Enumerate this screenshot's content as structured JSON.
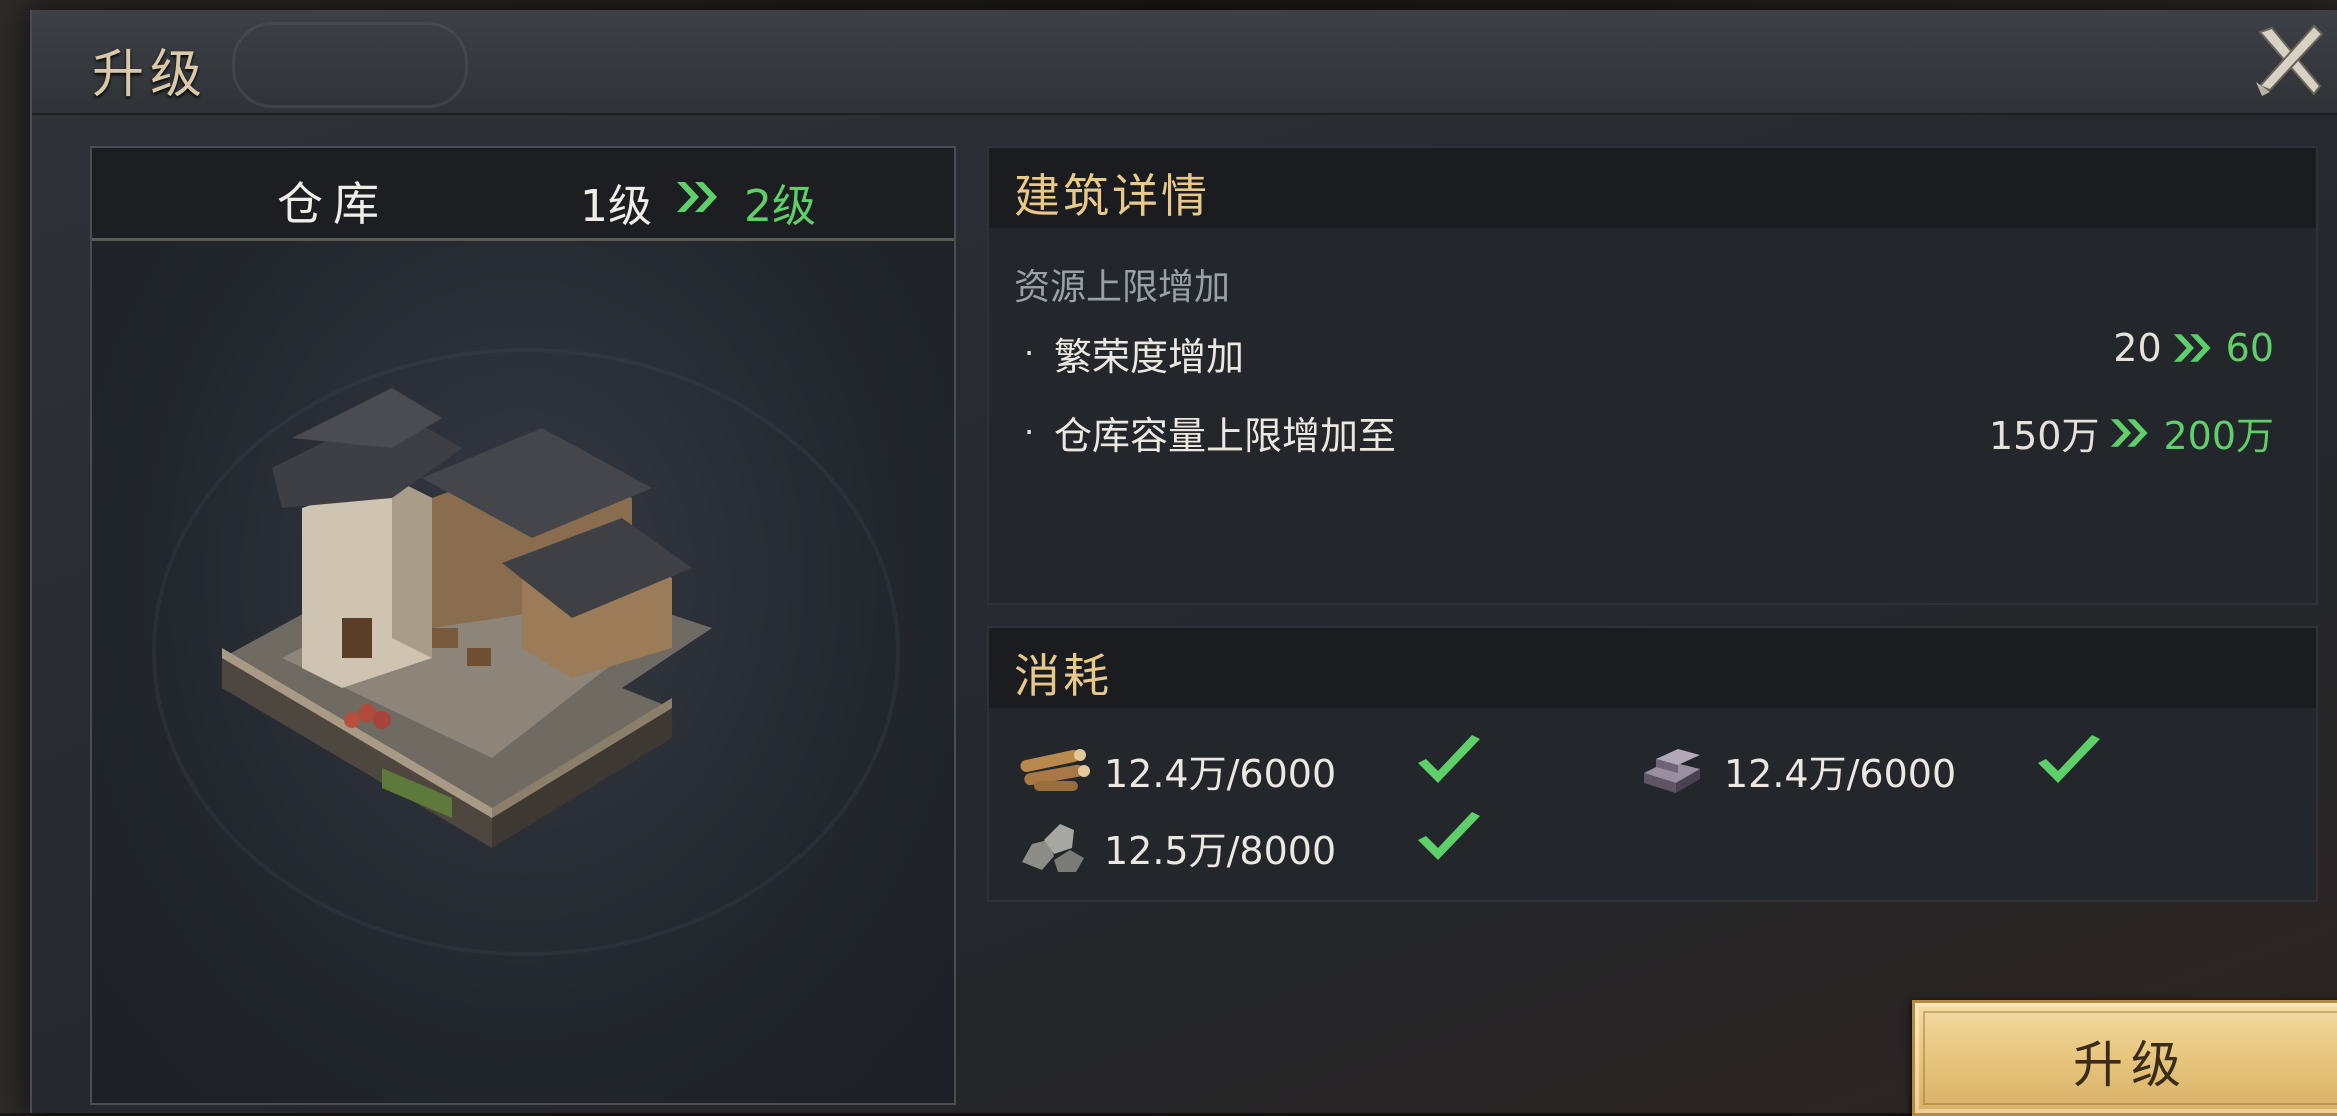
{
  "dialog": {
    "title": "升级",
    "close_icon": "close-x-icon"
  },
  "building": {
    "name": "仓库",
    "level_current": "1级",
    "level_next": "2级",
    "art": "warehouse-building-image"
  },
  "details": {
    "header": "建筑详情",
    "subtitle": "资源上限增加",
    "stats": [
      {
        "bullet": "·",
        "label": "繁荣度增加",
        "from": "20",
        "to": "60"
      },
      {
        "bullet": "·",
        "label": "仓库容量上限增加至",
        "from": "150万",
        "to": "200万"
      }
    ]
  },
  "cost": {
    "header": "消耗",
    "items": [
      {
        "icon": "wood-logs-icon",
        "text": "12.4万/6000",
        "satisfied": true
      },
      {
        "icon": "iron-ingot-icon",
        "text": "12.4万/6000",
        "satisfied": true
      },
      {
        "icon": "stone-icon",
        "text": "12.5万/8000",
        "satisfied": true
      }
    ]
  },
  "actions": {
    "upgrade_label": "升级"
  },
  "colors": {
    "accent_green": "#5ed06a",
    "header_gold": "#e8c98a",
    "button_gold": "#e7c57d"
  }
}
